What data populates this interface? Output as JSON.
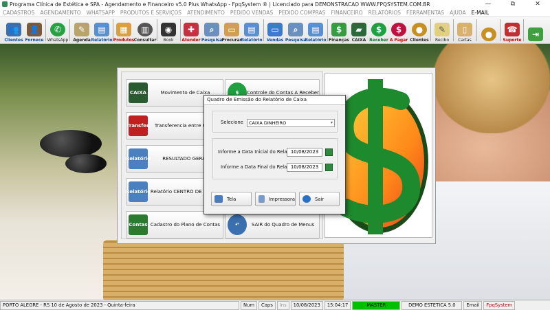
{
  "window": {
    "title": "Programa Clínica de Estética e SPA - Agendamento e Financeiro v5.0 Plus WhatsApp - FpqSystem ® | Licenciado para  DEMONSTRACAO WWW.FPQSYSTEM.COM.BR",
    "controls": [
      "—",
      "⧉",
      "✕"
    ]
  },
  "menu": [
    "CADASTROS",
    "AGENDAMENTO",
    "WHATSAPP",
    "PRODUTOS E SERVIÇOS",
    "ATENDIMENTO",
    "PEDIDO VENDAS",
    "PEDIDO COMPRAS",
    "FINANCEIRO",
    "RELATÓRIOS",
    "FERRAMENTAS",
    "AJUDA",
    "E-MAIL"
  ],
  "toolbar": [
    {
      "label": "Clientes",
      "icon": "clients-icon",
      "color": "#3a6fb0"
    },
    {
      "label": "Fornece",
      "icon": "suppliers-icon",
      "color": "#7a5a3a"
    },
    {
      "label": "WhatsApp",
      "icon": "whatsapp-icon",
      "color": "#25a244"
    },
    {
      "label": "Agenda",
      "icon": "agenda-icon",
      "color": "#b8a46a"
    },
    {
      "label": "Relatório",
      "icon": "report-icon",
      "color": "#5a8fd0"
    },
    {
      "label": "Produtos",
      "icon": "products-icon",
      "color": "#d8a040"
    },
    {
      "label": "Consultar",
      "icon": "consult-icon",
      "color": "#555555"
    },
    {
      "label": "Book",
      "icon": "camera-icon",
      "color": "#333333"
    },
    {
      "label": "Atender",
      "icon": "attend-icon",
      "color": "#c83040"
    },
    {
      "label": "Pesquisa",
      "icon": "search-icon",
      "color": "#6a90c0"
    },
    {
      "label": "Procurar",
      "icon": "folder-icon",
      "color": "#d0a050"
    },
    {
      "label": "Relatório",
      "icon": "report-icon",
      "color": "#5a8fd0"
    },
    {
      "label": "Vendas",
      "icon": "sales-icon",
      "color": "#3a7ad0"
    },
    {
      "label": "Pesquisa",
      "icon": "search-icon",
      "color": "#6a90c0"
    },
    {
      "label": "Relatório",
      "icon": "report-icon",
      "color": "#5a8fd0"
    },
    {
      "label": "Finanças",
      "icon": "finance-icon",
      "color": "#3a9a40"
    },
    {
      "label": "CAIXA",
      "icon": "cashier-icon",
      "color": "#2a6a3a"
    },
    {
      "label": "Receber",
      "icon": "receive-icon",
      "color": "#20a040"
    },
    {
      "label": "A Pagar",
      "icon": "pay-icon",
      "color": "#c01040"
    },
    {
      "label": "Clientes",
      "icon": "coins-icon",
      "color": "#c89020"
    },
    {
      "label": "Recibo",
      "icon": "receipt-icon",
      "color": "#e0d080"
    },
    {
      "label": "Cartas",
      "icon": "letters-icon",
      "color": "#d8b070"
    },
    {
      "label": "",
      "icon": "money-icon",
      "color": "#c89020"
    },
    {
      "label": "Suporte",
      "icon": "support-icon",
      "color": "#c03030"
    },
    {
      "label": "",
      "icon": "exit-icon",
      "color": "#40a040"
    }
  ],
  "menu_panel": {
    "buttons": [
      {
        "label": "Movimento de Caixa",
        "icon": "CAIXA",
        "color": "#2a5a30"
      },
      {
        "label": "Controle do Contas A Receber",
        "icon": "$",
        "color": "#20a040"
      },
      {
        "label": "Transferencia entre Caixa",
        "icon": "Transfer.",
        "color": "#c02020"
      },
      {
        "label": "RESULTADO GERAL",
        "icon": "Relatório",
        "color": "#4a80c0"
      },
      {
        "label": "Relatório CENTRO DE CUSTO",
        "icon": "Relatório",
        "color": "#4a80c0"
      },
      {
        "label": "Cadastro do Plano de Contas",
        "icon": "Contas",
        "color": "#2a7a30"
      },
      {
        "label": "SAIR do Quadro de Menus",
        "icon": "↶",
        "color": "#3a70b0"
      }
    ]
  },
  "dialog": {
    "title": "Quadro de Emissão do Relatório de Caixa",
    "select_label": "Selecione",
    "select_value": "CAIXA DINHEIRO",
    "start_label": "Informe a Data Inicial do Relatório",
    "start_value": "10/08/2023",
    "end_label": "Informe a Data Final do Relatório",
    "end_value": "10/08/2023",
    "btn_tela": "Tela",
    "btn_impressora": "Impressora",
    "btn_sair": "Sair"
  },
  "statusbar": {
    "location": "PORTO ALEGRE - RS 10 de Agosto de 2023 - Quinta-feira",
    "num": "Num",
    "caps": "Caps",
    "ins": "Ins",
    "date": "10/08/2023",
    "time": "15:04:17",
    "user": "MASTER",
    "company": "DEMO ESTETICA 5.0",
    "email": "Email",
    "brand": "FpqSystem"
  },
  "colors": {
    "accent_green": "#00c000",
    "brand_red": "#c00000"
  }
}
